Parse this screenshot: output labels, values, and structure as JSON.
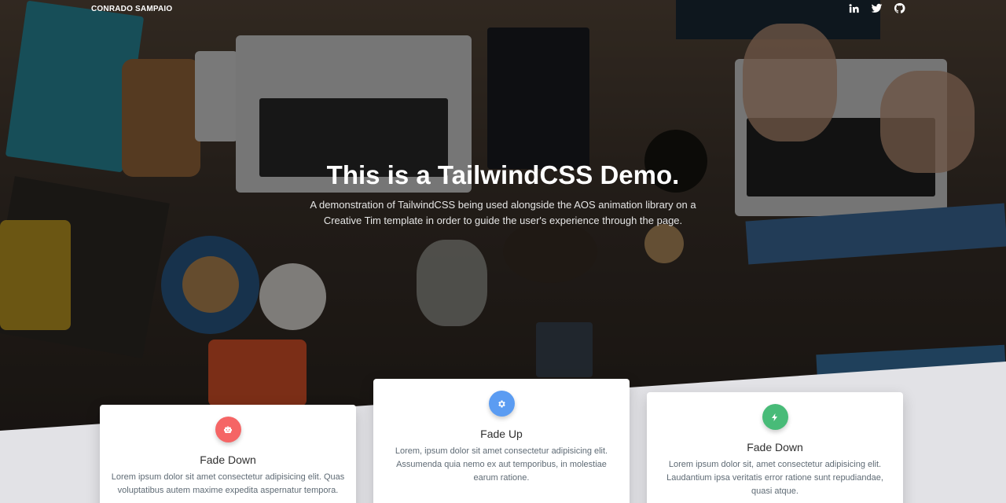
{
  "nav": {
    "brand": "CONRADO SAMPAIO",
    "social": [
      {
        "name": "linkedin-icon"
      },
      {
        "name": "twitter-icon"
      },
      {
        "name": "github-icon"
      }
    ]
  },
  "hero": {
    "title": "This is a TailwindCSS Demo.",
    "subtitle": "A demonstration of TailwindCSS being used alongside the AOS animation library on a Creative Tim template in order to guide the user's experience through the page."
  },
  "cards": [
    {
      "icon": "robot-icon",
      "icon_color": "#f56565",
      "title": "Fade Down",
      "text": "Lorem ipsum dolor sit amet consectetur adipisicing elit. Quas voluptatibus autem maxime expedita aspernatur tempora."
    },
    {
      "icon": "gear-icon",
      "icon_color": "#5b9cf2",
      "title": "Fade Up",
      "text": "Lorem, ipsum dolor sit amet consectetur adipisicing elit. Assumenda quia nemo ex aut temporibus, in molestiae earum ratione."
    },
    {
      "icon": "lightning-icon",
      "icon_color": "#48bb78",
      "title": "Fade Down",
      "text": "Lorem ipsum dolor sit, amet consectetur adipisicing elit. Laudantium ipsa veritatis error ratione sunt repudiandae, quasi atque."
    }
  ],
  "colors": {
    "page_background": "#e2e2e6",
    "card_background": "#ffffff"
  }
}
